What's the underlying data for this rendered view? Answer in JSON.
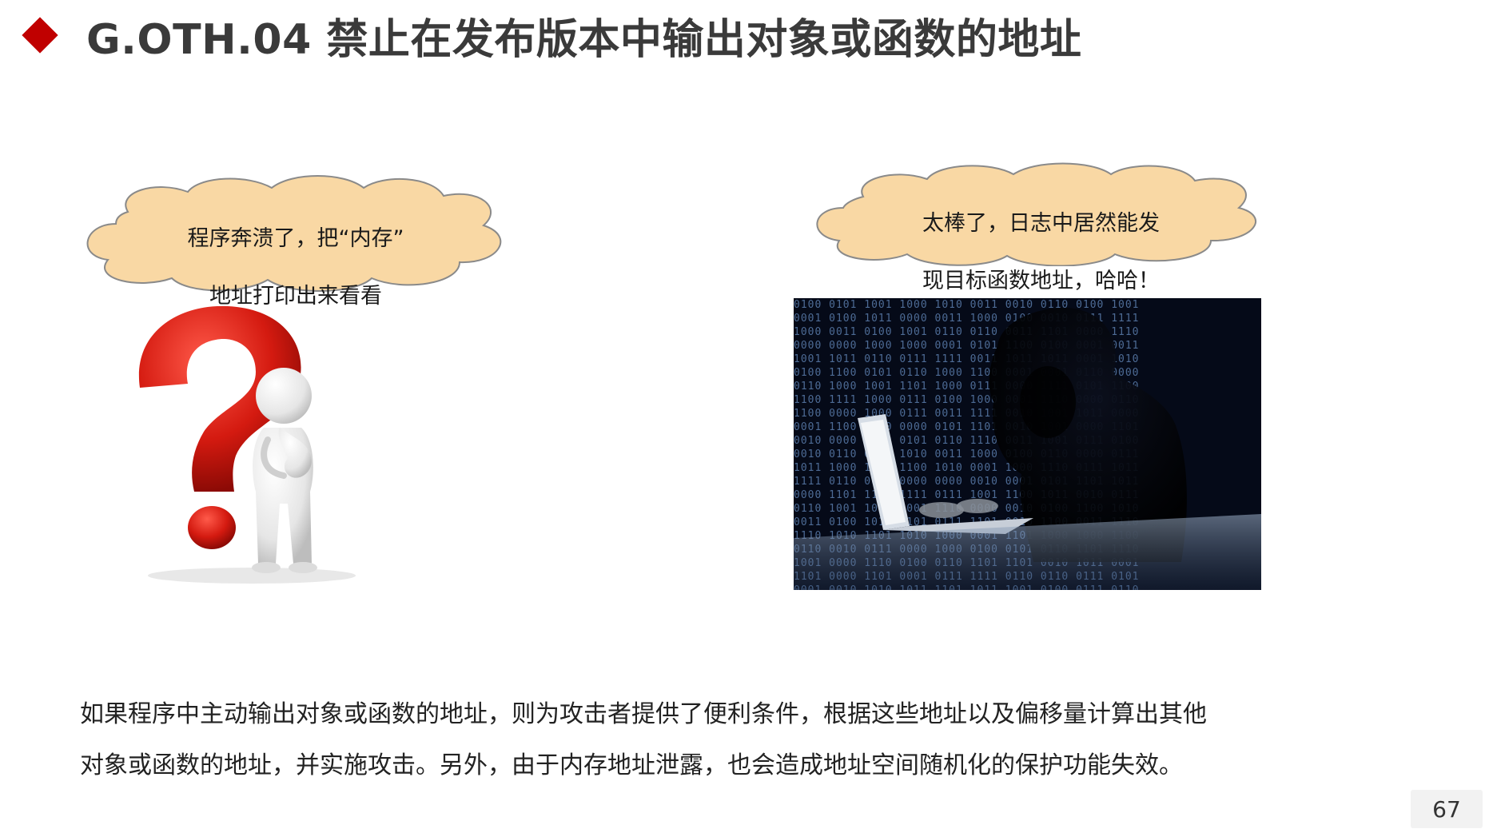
{
  "slide": {
    "title": "G.OTH.04 禁止在发布版本中输出对象或函数的地址",
    "bubble_left": {
      "line1": "程序奔溃了，把“内存”",
      "line2": "地址打印出来看看"
    },
    "bubble_right": {
      "line1": "太棒了，日志中居然能发",
      "line2": "现目标函数地址，哈哈！"
    },
    "paragraph": {
      "line1": "如果程序中主动输出对象或函数的地址，则为攻击者提供了便利条件，根据这些地址以及偏移量计算出其他",
      "line2": "对象或函数的地址，并实施攻击。另外，由于内存地址泄露，也会造成地址空间随机化的保护功能失效。"
    },
    "page_number": "67"
  },
  "colors": {
    "accent": "#c00000",
    "title_text": "#3a3a3a",
    "cloud_fill": "#f9d8a4",
    "cloud_stroke": "#8a8a8a",
    "page_num_bg": "#f2f2f2"
  },
  "icons": {
    "title_bullet": "red-diamond-icon",
    "left_illustration": "question-mark-person-illustration",
    "right_illustration": "hooded-hacker-binary-photo"
  }
}
